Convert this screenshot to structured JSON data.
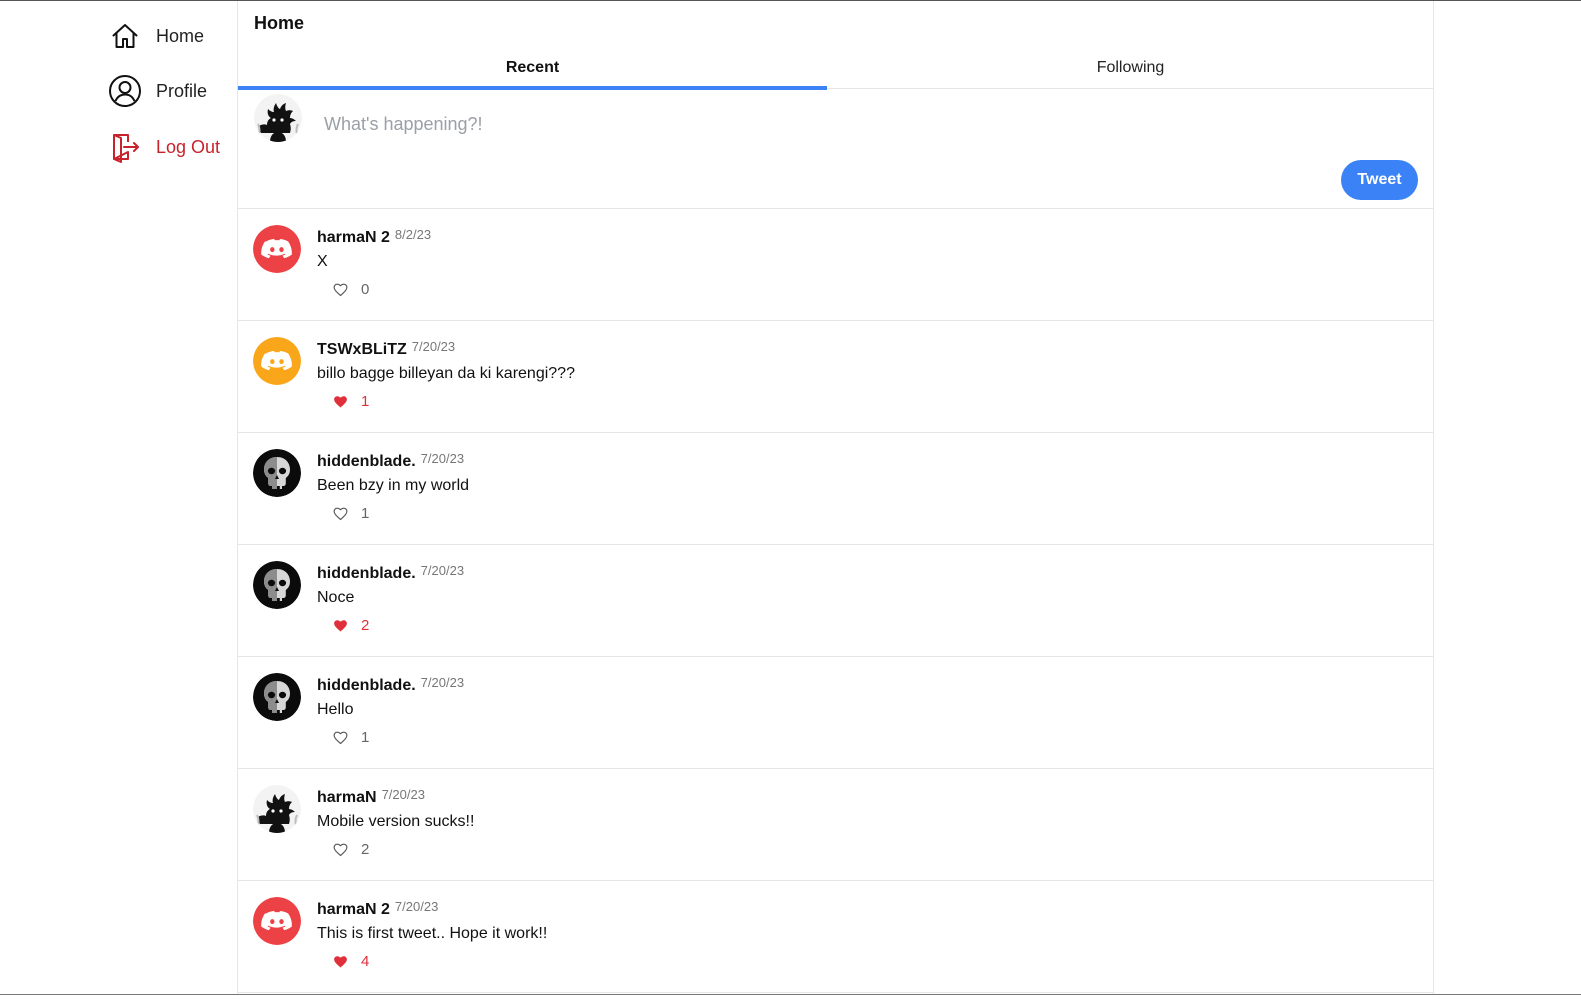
{
  "sidebar": {
    "items": [
      {
        "label": "Home",
        "icon": "home-icon"
      },
      {
        "label": "Profile",
        "icon": "profile-icon"
      },
      {
        "label": "Log Out",
        "icon": "logout-icon"
      }
    ]
  },
  "header": {
    "title": "Home"
  },
  "tabs": [
    {
      "label": "Recent",
      "active": true
    },
    {
      "label": "Following",
      "active": false
    }
  ],
  "composer": {
    "placeholder": "What's happening?!",
    "button_label": "Tweet"
  },
  "colors": {
    "accent": "#3b82f6",
    "logout": "#c8232c",
    "like": "#e0303b",
    "discord_red": "#ed4245",
    "discord_orange": "#faa61a"
  },
  "posts": [
    {
      "author": "harmaN 2",
      "date": "8/2/23",
      "text": "X",
      "likes": "0",
      "liked": false,
      "avatar": "discord-red"
    },
    {
      "author": "TSWxBLiTZ",
      "date": "7/20/23",
      "text": "billo bagge billeyan da ki karengi???",
      "likes": "1",
      "liked": true,
      "avatar": "discord-orange"
    },
    {
      "author": "hiddenblade.",
      "date": "7/20/23",
      "text": "Been bzy in my world",
      "likes": "1",
      "liked": false,
      "avatar": "skull"
    },
    {
      "author": "hiddenblade.",
      "date": "7/20/23",
      "text": "Noce",
      "likes": "2",
      "liked": true,
      "avatar": "skull"
    },
    {
      "author": "hiddenblade.",
      "date": "7/20/23",
      "text": "Hello",
      "likes": "1",
      "liked": false,
      "avatar": "skull"
    },
    {
      "author": "harmaN",
      "date": "7/20/23",
      "text": "Mobile version sucks!!",
      "likes": "2",
      "liked": false,
      "avatar": "spiky"
    },
    {
      "author": "harmaN 2",
      "date": "7/20/23",
      "text": "This is first tweet.. Hope it work!!",
      "likes": "4",
      "liked": true,
      "avatar": "discord-red"
    }
  ]
}
